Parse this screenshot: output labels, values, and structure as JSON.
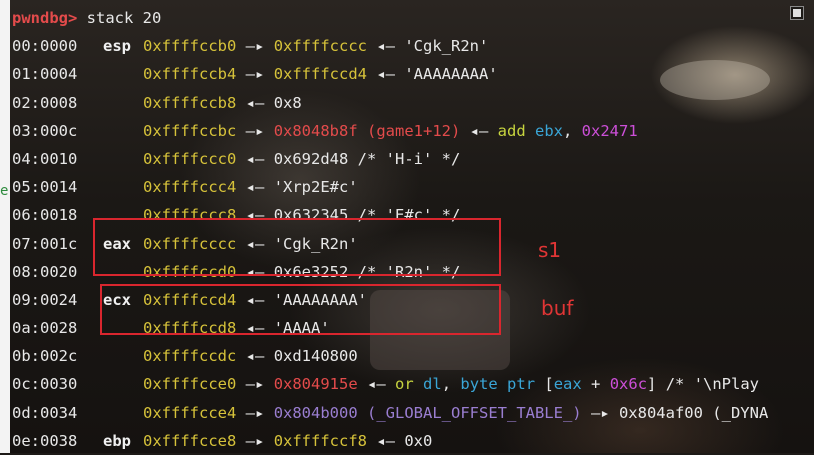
{
  "prompt": "pwndbg>",
  "command": "stack 20",
  "rows": [
    {
      "idx": "00:0000",
      "reg": "esp",
      "addr": "0xffffccb0",
      "sep": "—▸",
      "rest": [
        {
          "t": "0xffffcccc",
          "c": "addr"
        },
        {
          "t": " ◂— 'Cgk_R2n'",
          "c": "arrow"
        }
      ]
    },
    {
      "idx": "01:0004",
      "reg": "",
      "addr": "0xffffccb4",
      "sep": "—▸",
      "rest": [
        {
          "t": "0xffffccd4",
          "c": "addr"
        },
        {
          "t": " ◂— 'AAAAAAAA'",
          "c": "arrow"
        }
      ]
    },
    {
      "idx": "02:0008",
      "reg": "",
      "addr": "0xffffccb8",
      "sep": "◂—",
      "rest": [
        {
          "t": "0x8",
          "c": "arrow"
        }
      ]
    },
    {
      "idx": "03:000c",
      "reg": "",
      "addr": "0xffffccbc",
      "sep": "—▸",
      "rest": [
        {
          "t": "0x8048b8f (game1+12)",
          "c": "code"
        },
        {
          "t": " ◂— ",
          "c": "arrow"
        },
        {
          "t": "add",
          "c": "instr"
        },
        {
          "t": " ",
          "c": "arrow"
        },
        {
          "t": "ebx",
          "c": "regname"
        },
        {
          "t": ", ",
          "c": "arrow"
        },
        {
          "t": "0x2471",
          "c": "num"
        }
      ]
    },
    {
      "idx": "04:0010",
      "reg": "",
      "addr": "0xffffccc0",
      "sep": "◂—",
      "rest": [
        {
          "t": "0x692d48 /* 'H-i' */",
          "c": "arrow"
        }
      ]
    },
    {
      "idx": "05:0014",
      "reg": "",
      "addr": "0xffffccc4",
      "sep": "◂—",
      "rest": [
        {
          "t": "'Xrp2E#c'",
          "c": "arrow"
        }
      ]
    },
    {
      "idx": "06:0018",
      "reg": "",
      "addr": "0xffffccc8",
      "sep": "◂—",
      "rest": [
        {
          "t": "0x632345 /* 'E#c' */",
          "c": "arrow"
        }
      ]
    },
    {
      "idx": "07:001c",
      "reg": "eax",
      "addr": "0xffffcccc",
      "sep": "◂—",
      "rest": [
        {
          "t": "'Cgk_R2n'",
          "c": "arrow"
        }
      ]
    },
    {
      "idx": "08:0020",
      "reg": "",
      "addr": "0xffffccd0",
      "sep": "◂—",
      "rest": [
        {
          "t": "0x6e3252 /* 'R2n' */",
          "c": "arrow"
        }
      ]
    },
    {
      "idx": "09:0024",
      "reg": "ecx",
      "addr": "0xffffccd4",
      "sep": "◂—",
      "rest": [
        {
          "t": "'AAAAAAAA'",
          "c": "arrow"
        }
      ]
    },
    {
      "idx": "0a:0028",
      "reg": "",
      "addr": "0xffffccd8",
      "sep": "◂—",
      "rest": [
        {
          "t": "'AAAA'",
          "c": "arrow"
        }
      ]
    },
    {
      "idx": "0b:002c",
      "reg": "",
      "addr": "0xffffccdc",
      "sep": "◂—",
      "rest": [
        {
          "t": "0xd140800",
          "c": "arrow"
        }
      ]
    },
    {
      "idx": "0c:0030",
      "reg": "",
      "addr": "0xffffcce0",
      "sep": "—▸",
      "rest": [
        {
          "t": "0x804915e",
          "c": "code"
        },
        {
          "t": " ◂— ",
          "c": "arrow"
        },
        {
          "t": "or",
          "c": "instr"
        },
        {
          "t": " ",
          "c": "arrow"
        },
        {
          "t": "dl",
          "c": "regname"
        },
        {
          "t": ", ",
          "c": "arrow"
        },
        {
          "t": "byte ptr",
          "c": "regname"
        },
        {
          "t": " [",
          "c": "arrow"
        },
        {
          "t": "eax",
          "c": "regname"
        },
        {
          "t": " + ",
          "c": "arrow"
        },
        {
          "t": "0x6c",
          "c": "num"
        },
        {
          "t": "] /* '\\nPlay",
          "c": "arrow"
        }
      ]
    },
    {
      "idx": "0d:0034",
      "reg": "",
      "addr": "0xffffcce4",
      "sep": "—▸",
      "rest": [
        {
          "t": "0x804b000 (_GLOBAL_OFFSET_TABLE_)",
          "c": "data-sym"
        },
        {
          "t": " —▸ 0x804af00 (_DYNA",
          "c": "arrow"
        }
      ]
    },
    {
      "idx": "0e:0038",
      "reg": "ebp",
      "addr": "0xffffcce8",
      "sep": "—▸",
      "rest": [
        {
          "t": "0xffffccf8",
          "c": "addr"
        },
        {
          "t": " ◂— 0x0",
          "c": "arrow"
        }
      ]
    }
  ],
  "annotations": {
    "s1": "s1",
    "buf": "buf"
  },
  "margin_letter": "e"
}
